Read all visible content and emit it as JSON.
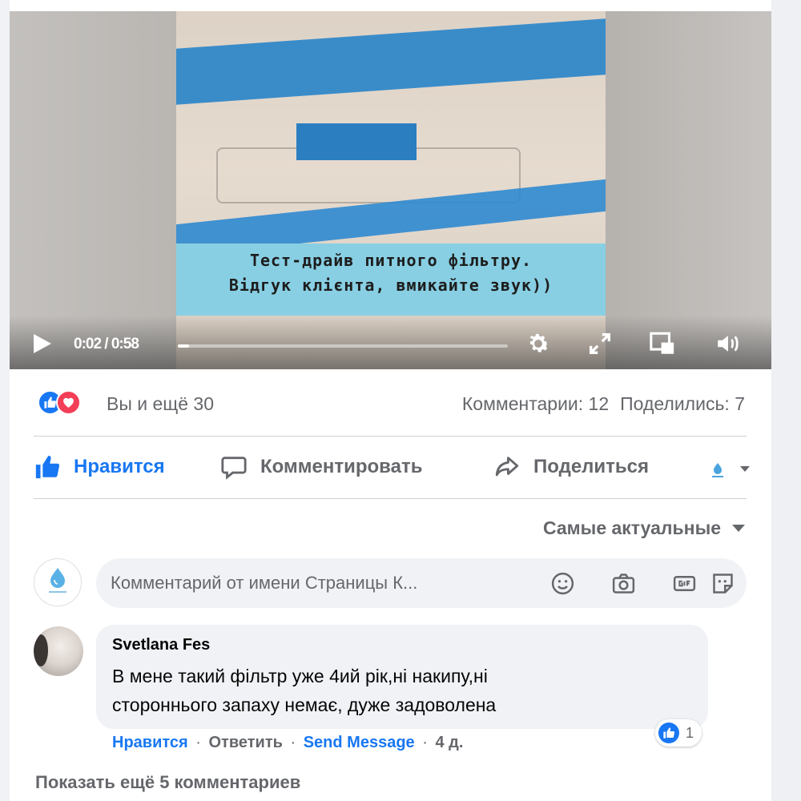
{
  "video": {
    "caption_line1": "Тест-драйв питного фільтру.",
    "caption_line2": "Відгук клієнта, вмикайте звук))",
    "time": "0:02 / 0:58",
    "progress": 0.035
  },
  "reactions": {
    "reactors_text": "Вы и ещё 30",
    "comments_label": "Комментарии: 12",
    "shares_label": "Поделились: 7"
  },
  "actions": {
    "like_label": "Нравится",
    "comment_label": "Комментировать",
    "share_label": "Поделиться"
  },
  "sort": {
    "label": "Самые актуальные"
  },
  "comment_input": {
    "placeholder": "Комментарий от имени Страницы К..."
  },
  "comment": {
    "author": "Svetlana Fes",
    "text_line1": "В мене такий фільтр уже 4ий рік,ні накипу,ні",
    "text_line2": "стороннього запаху немає, дуже задоволена",
    "like": "Нравится",
    "reply": "Ответить",
    "send_message": "Send Message",
    "time": "4 д.",
    "reaction_count": "1"
  },
  "more_comments": "Показать ещё 5 комментариев",
  "colors": {
    "accent": "#1877f2",
    "love": "#f33e58",
    "caption_band": "#88cfe3"
  },
  "icons": [
    "play-icon",
    "settings-gear-icon",
    "fullscreen-icon",
    "picture-in-picture-icon",
    "volume-icon",
    "like-thumb-icon",
    "heart-icon",
    "comment-icon",
    "share-icon",
    "emoji-icon",
    "camera-icon",
    "gif-icon",
    "sticker-icon"
  ]
}
